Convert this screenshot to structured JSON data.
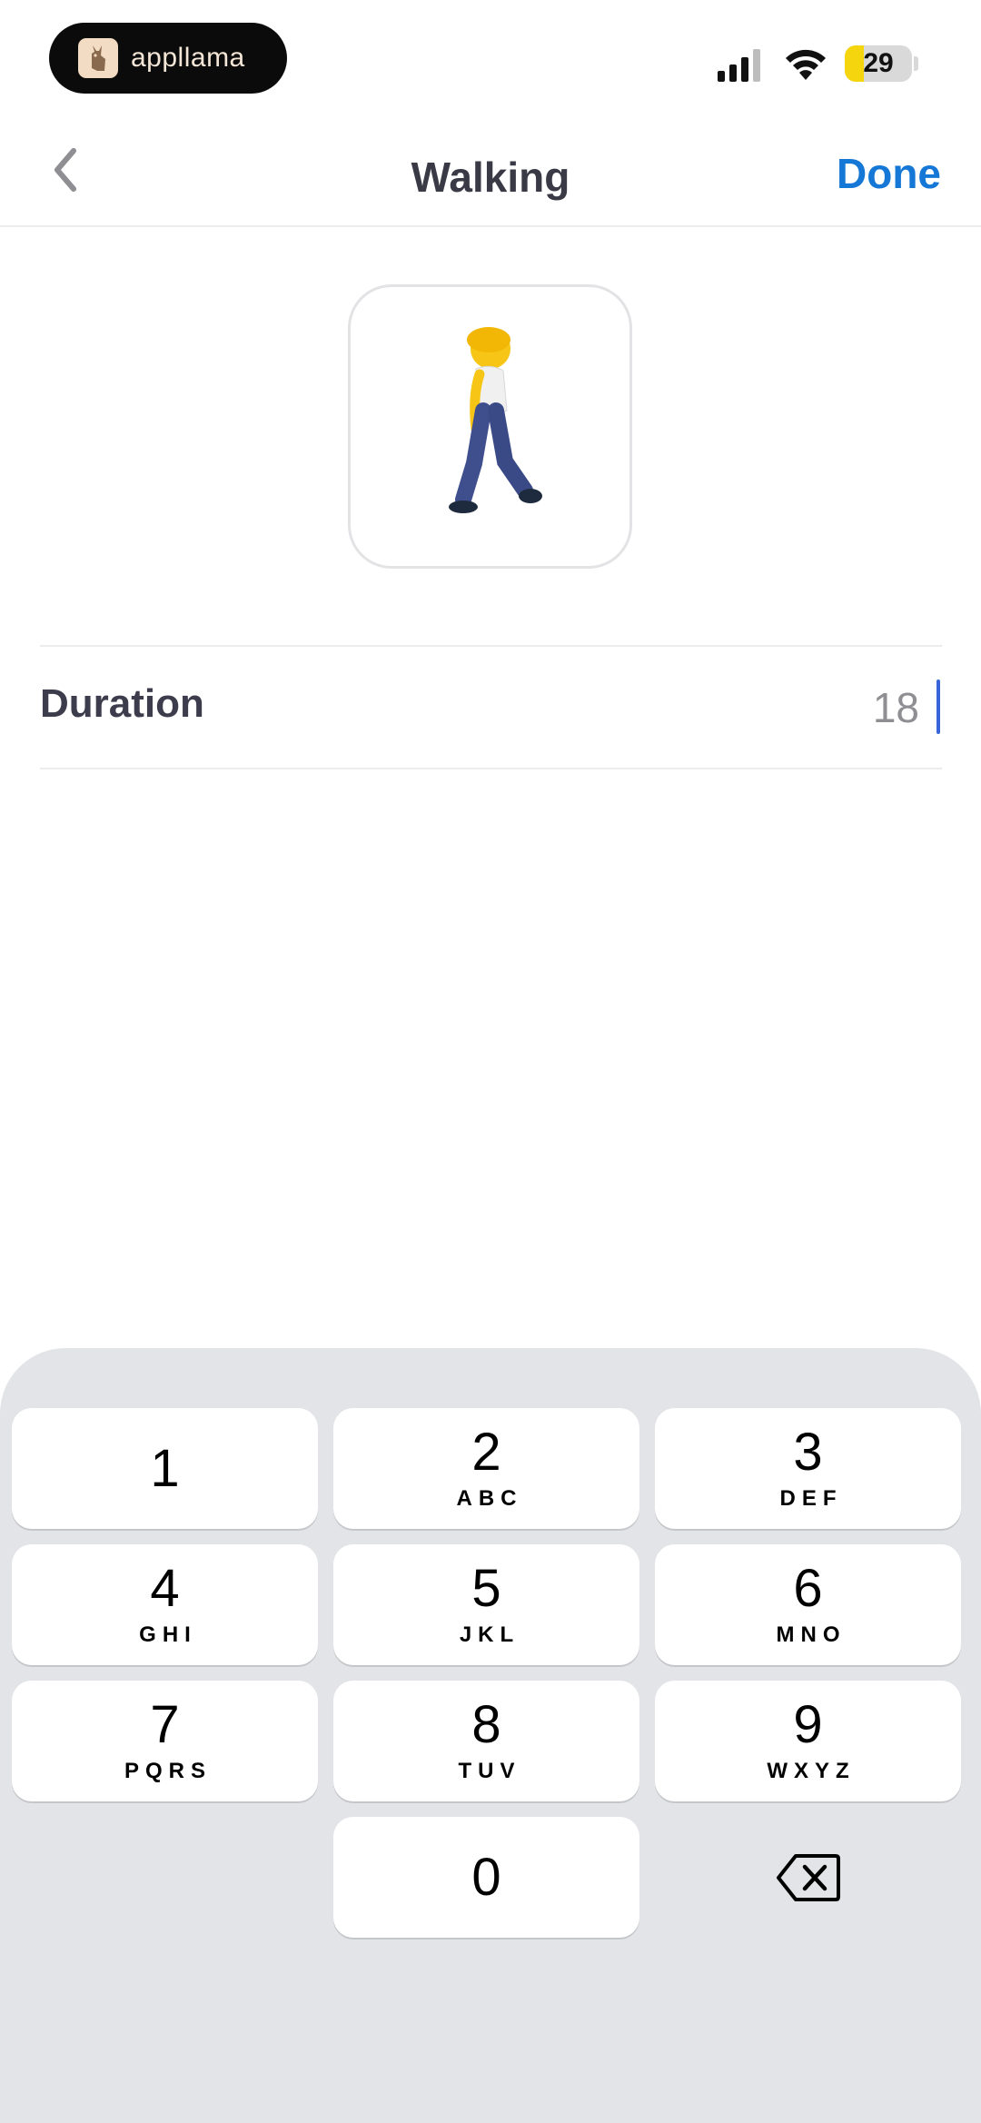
{
  "status_bar": {
    "brand_name": "appllama",
    "battery_level": "29",
    "battery_fraction": 0.29,
    "colors": {
      "battery_fill": "#f5d50e",
      "pill_bg": "#0b0b0b"
    }
  },
  "nav": {
    "back_icon": "chevron-left-icon",
    "title": "Walking",
    "done_label": "Done",
    "accent_color": "#1577d6"
  },
  "activity": {
    "emoji": "🚶",
    "icon": "person-walking-icon"
  },
  "duration": {
    "label": "Duration",
    "value": "18"
  },
  "keypad": {
    "keys": [
      {
        "digit": "1",
        "letters": ""
      },
      {
        "digit": "2",
        "letters": "ABC"
      },
      {
        "digit": "3",
        "letters": "DEF"
      },
      {
        "digit": "4",
        "letters": "GHI"
      },
      {
        "digit": "5",
        "letters": "JKL"
      },
      {
        "digit": "6",
        "letters": "MNO"
      },
      {
        "digit": "7",
        "letters": "PQRS"
      },
      {
        "digit": "8",
        "letters": "TUV"
      },
      {
        "digit": "9",
        "letters": "WXYZ"
      },
      {
        "digit": "0",
        "letters": ""
      }
    ],
    "delete_icon": "backspace-icon"
  }
}
